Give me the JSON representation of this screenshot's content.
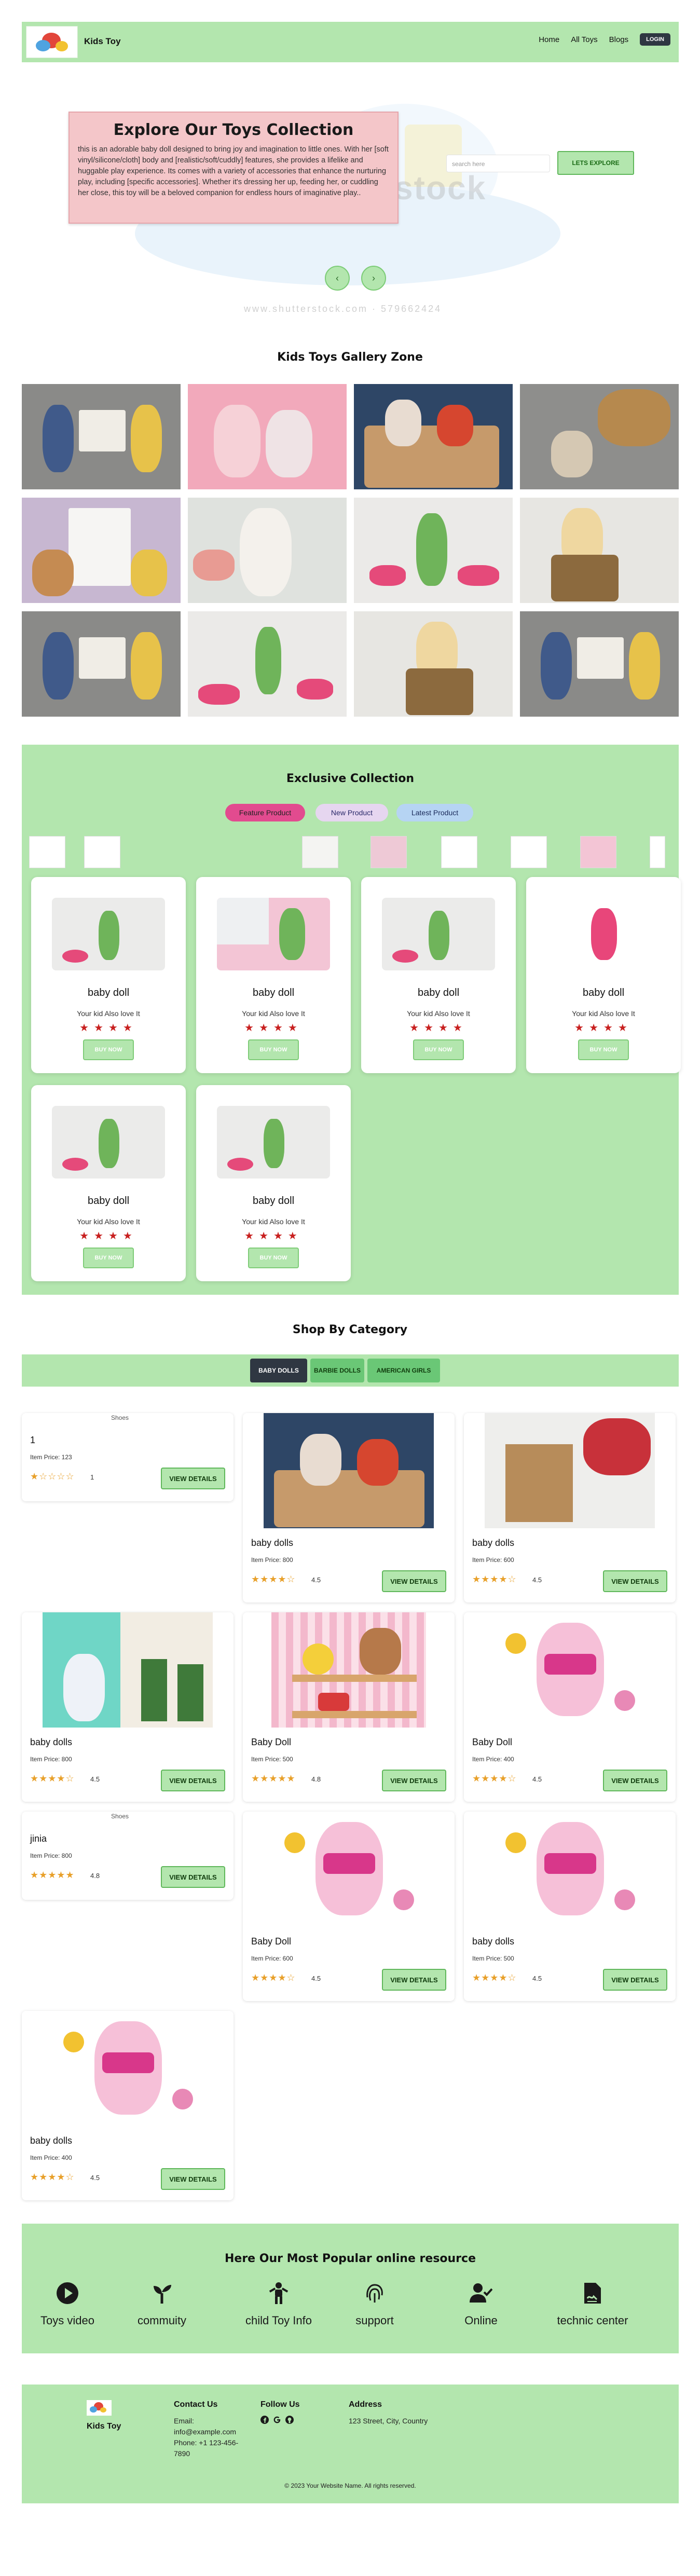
{
  "nav": {
    "brand": "Kids Toy",
    "links": [
      "Home",
      "All Toys",
      "Blogs"
    ],
    "login": "LOGIN"
  },
  "hero": {
    "title": "Explore Our Toys Collection",
    "text": "this is an adorable baby doll designed to bring joy and imagination to little ones. With her [soft vinyl/silicone/cloth] body and [realistic/soft/cuddly] features, she provides a lifelike and huggable play experience. Its comes with a variety of accessories that enhance the nurturing play, including [specific accessories]. Whether it's dressing her up, feeding her, or cuddling her close, this toy will be a beloved companion for endless hours of imaginative play..",
    "search_placeholder": "search here",
    "button": "LETS EXPLORE",
    "prev": "‹",
    "next": "›",
    "watermark": "stock",
    "watermark_id": "www.shutterstock.com · 579662424"
  },
  "gallery": {
    "title": "Kids Toys Gallery Zone"
  },
  "exclusive": {
    "title": "Exclusive Collection",
    "tabs": [
      "Feature Product",
      "New Product",
      "Latest Product"
    ],
    "products": [
      {
        "title": "baby doll",
        "subtitle": "Your kid Also love It",
        "stars": "★★★★",
        "button": "BUY NOW"
      },
      {
        "title": "baby doll",
        "subtitle": "Your kid Also love It",
        "stars": "★★★★",
        "button": "BUY NOW"
      },
      {
        "title": "baby doll",
        "subtitle": "Your kid Also love It",
        "stars": "★★★★",
        "button": "BUY NOW"
      },
      {
        "title": "baby doll",
        "subtitle": "Your kid Also love It",
        "stars": "★★★★",
        "button": "BUY NOW"
      },
      {
        "title": "baby doll",
        "subtitle": "Your kid Also love It",
        "stars": "★★★★",
        "button": "BUY NOW"
      },
      {
        "title": "baby doll",
        "subtitle": "Your kid Also love It",
        "stars": "★★★★",
        "button": "BUY NOW"
      }
    ]
  },
  "category": {
    "title": "Shop By Category",
    "tabs": [
      "BABY DOLLS",
      "BARBIE DOLLS",
      "AMERICAN GIRLS"
    ],
    "items": [
      {
        "alt": "Shoes",
        "title": "1",
        "price": "Item Price: 123",
        "stars": "★☆☆☆☆",
        "rating": "1",
        "button": "VIEW DETAILS"
      },
      {
        "title": "baby dolls",
        "price": "Item Price: 800",
        "stars": "★★★★☆",
        "rating": "4.5",
        "button": "VIEW DETAILS"
      },
      {
        "title": "baby dolls",
        "price": "Item Price: 600",
        "stars": "★★★★☆",
        "rating": "4.5",
        "button": "VIEW DETAILS"
      },
      {
        "title": "baby dolls",
        "price": "Item Price: 800",
        "stars": "★★★★☆",
        "rating": "4.5",
        "button": "VIEW DETAILS"
      },
      {
        "title": "Baby Doll",
        "price": "Item Price: 500",
        "stars": "★★★★★",
        "rating": "4.8",
        "button": "VIEW DETAILS"
      },
      {
        "title": "Baby Doll",
        "price": "Item Price: 400",
        "stars": "★★★★☆",
        "rating": "4.5",
        "button": "VIEW DETAILS"
      },
      {
        "alt": "Shoes",
        "title": "jinia",
        "price": "Item Price: 800",
        "stars": "★★★★★",
        "rating": "4.8",
        "button": "VIEW DETAILS"
      },
      {
        "title": "Baby Doll",
        "price": "Item Price: 600",
        "stars": "★★★★☆",
        "rating": "4.5",
        "button": "VIEW DETAILS"
      },
      {
        "title": "baby dolls",
        "price": "Item Price: 500",
        "stars": "★★★★☆",
        "rating": "4.5",
        "button": "VIEW DETAILS"
      },
      {
        "title": "baby dolls",
        "price": "Item Price: 400",
        "stars": "★★★★☆",
        "rating": "4.5",
        "button": "VIEW DETAILS"
      }
    ]
  },
  "resources": {
    "title": "Here Our Most Popular online resource",
    "items": [
      {
        "label": "Toys video",
        "icon": "play-circle-icon"
      },
      {
        "label": "commuity",
        "icon": "seedling-icon"
      },
      {
        "label": "child Toy Info",
        "icon": "child-icon"
      },
      {
        "label": "support",
        "icon": "fingerprint-icon"
      },
      {
        "label": "Online",
        "icon": "user-check-icon"
      },
      {
        "label": "technic center",
        "icon": "file-signature-icon"
      }
    ]
  },
  "footer": {
    "brand": "Kids Toy",
    "contact_title": "Contact Us",
    "email": "Email:",
    "email_value": "info@example.com",
    "phone_line1": "Phone: +1 123-456-",
    "phone_line2": "7890",
    "follow_title": "Follow Us",
    "address_title": "Address",
    "address": "123 Street, City, Country",
    "copyright": "© 2023 Your Website Name. All rights reserved."
  },
  "colors": {
    "accent_green": "#b3e6ae",
    "tab_feature": "#e24b8f",
    "tab_new": "#e6d6f0",
    "tab_latest": "#b6d4f3",
    "star_red": "#c8201f",
    "star_gold": "#e8a02a",
    "dark_button": "#2f3742"
  }
}
